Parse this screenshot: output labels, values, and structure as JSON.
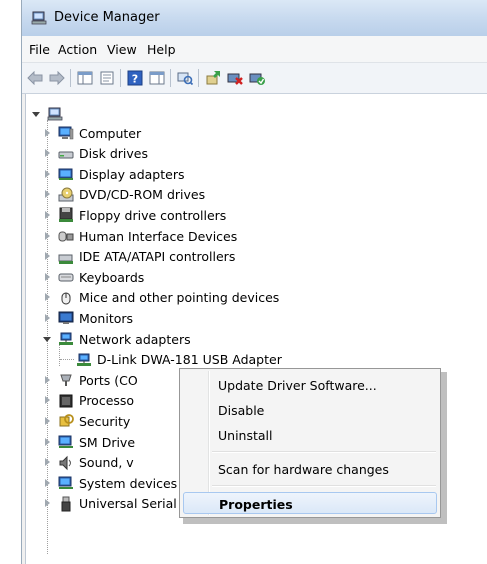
{
  "window": {
    "title": "Device Manager"
  },
  "menubar": {
    "items": [
      "File",
      "Action",
      "View",
      "Help"
    ]
  },
  "toolbar": {
    "icons": [
      "back-icon",
      "forward-icon",
      "show-hide-console-tree-icon",
      "properties-icon",
      "help-icon",
      "action-pane-icon",
      "scan-icon",
      "update-driver-icon",
      "uninstall-icon",
      "enable-icon"
    ]
  },
  "tree": {
    "root": {
      "label": "",
      "expanded": true,
      "icon": "computer-root-icon"
    },
    "categories": [
      {
        "label": "Computer",
        "icon": "computer-icon"
      },
      {
        "label": "Disk drives",
        "icon": "disk-drive-icon"
      },
      {
        "label": "Display adapters",
        "icon": "display-adapter-icon"
      },
      {
        "label": "DVD/CD-ROM drives",
        "icon": "dvd-drive-icon"
      },
      {
        "label": "Floppy drive controllers",
        "icon": "floppy-controller-icon"
      },
      {
        "label": "Human Interface Devices",
        "icon": "hid-icon"
      },
      {
        "label": "IDE ATA/ATAPI controllers",
        "icon": "ide-controller-icon"
      },
      {
        "label": "Keyboards",
        "icon": "keyboard-icon"
      },
      {
        "label": "Mice and other pointing devices",
        "icon": "mouse-icon"
      },
      {
        "label": "Monitors",
        "icon": "monitor-icon"
      },
      {
        "label": "Network adapters",
        "icon": "network-adapter-icon",
        "expanded": true
      },
      {
        "label": "D-Link DWA-181 USB Adapter",
        "icon": "network-adapter-icon",
        "child": true
      },
      {
        "label": "Ports (CO",
        "icon": "port-icon"
      },
      {
        "label": "Processo",
        "icon": "processor-icon"
      },
      {
        "label": "Security",
        "icon": "security-device-icon"
      },
      {
        "label": "SM Drive",
        "icon": "storage-controller-icon"
      },
      {
        "label": "Sound, v",
        "icon": "sound-icon"
      },
      {
        "label": "System devices",
        "icon": "system-device-icon"
      },
      {
        "label": "Universal Serial Bus controllers",
        "icon": "usb-icon"
      }
    ]
  },
  "context_menu": {
    "items": [
      "Update Driver Software...",
      "Disable",
      "Uninstall",
      "Scan for hardware changes",
      "Properties"
    ],
    "selected": "Properties"
  },
  "colors": {
    "accent": "#3399ff",
    "titlebar": "#c8daef",
    "menu_highlight": "#dbe8f8"
  }
}
